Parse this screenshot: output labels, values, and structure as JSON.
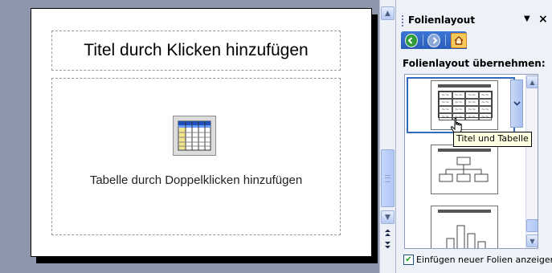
{
  "slide": {
    "title_placeholder": "Titel durch Klicken hinzufügen",
    "body_placeholder": "Tabelle durch Doppelklicken hinzufügen"
  },
  "taskpane": {
    "title": "Folienlayout",
    "dropdown_icon": "▼",
    "close_icon": "×",
    "section_label": "Folienlayout übernehmen:",
    "tooltip": "Titel und Tabelle",
    "checkbox_label": "Einfügen neuer Folien anzeigen",
    "checkbox_checked": true
  },
  "icons": {
    "back": "back-arrow-icon",
    "forward": "forward-arrow-icon",
    "home": "home-icon",
    "table": "table-icon"
  },
  "colors": {
    "workspace": "#8e96ab",
    "pane_bg": "#eef1f8",
    "selection": "#316ac5",
    "tooltip_bg": "#ffffe1"
  }
}
